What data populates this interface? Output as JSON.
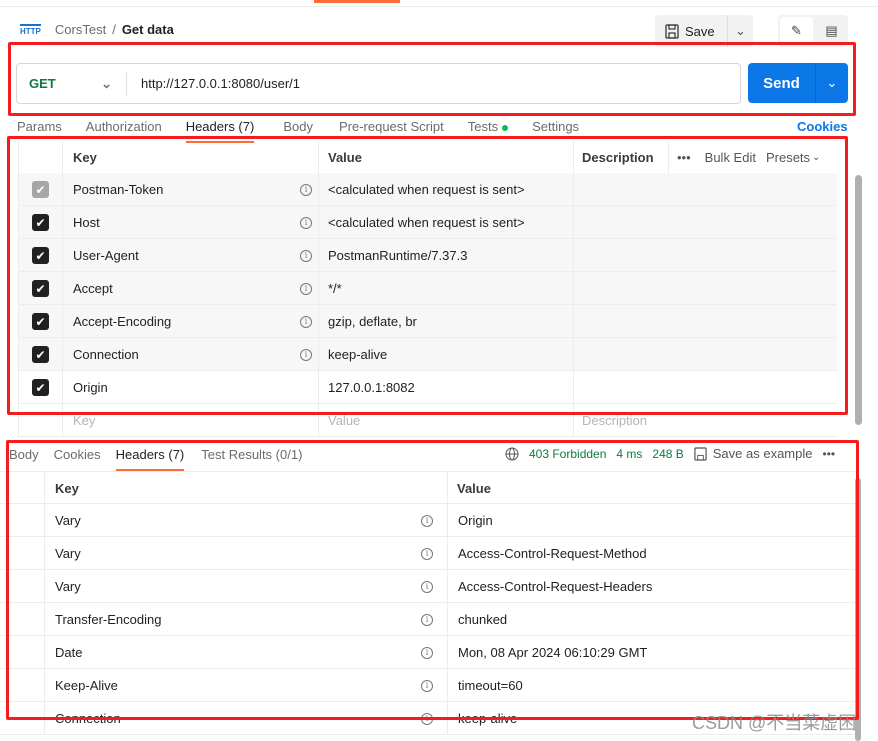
{
  "breadcrumb": {
    "icon": "http-icon",
    "icon_text": "HTTP",
    "collection": "CorsTest",
    "separator": "/",
    "request": "Get data"
  },
  "toolbar": {
    "save_label": "Save"
  },
  "request": {
    "method": "GET",
    "url": "http://127.0.0.1:8080/user/1",
    "send_label": "Send"
  },
  "request_tabs": [
    {
      "label": "Params"
    },
    {
      "label": "Authorization"
    },
    {
      "label": "Headers (7)",
      "active": true
    },
    {
      "label": "Body"
    },
    {
      "label": "Pre-request Script"
    },
    {
      "label": "Tests",
      "dot_color": "#0cbb52"
    },
    {
      "label": "Settings"
    }
  ],
  "cookies_label": "Cookies",
  "request_headers": {
    "columns": {
      "key": "Key",
      "value": "Value",
      "description": "Description",
      "bulk_edit": "Bulk Edit",
      "presets": "Presets"
    },
    "rows": [
      {
        "checked": true,
        "disabled": true,
        "key": "Postman-Token",
        "value": "<calculated when request is sent>",
        "auto": true
      },
      {
        "checked": true,
        "key": "Host",
        "value": "<calculated when request is sent>",
        "auto": true
      },
      {
        "checked": true,
        "key": "User-Agent",
        "value": "PostmanRuntime/7.37.3",
        "auto": true
      },
      {
        "checked": true,
        "key": "Accept",
        "value": "*/*",
        "auto": true
      },
      {
        "checked": true,
        "key": "Accept-Encoding",
        "value": "gzip, deflate, br",
        "auto": true
      },
      {
        "checked": true,
        "key": "Connection",
        "value": "keep-alive",
        "auto": true
      },
      {
        "checked": true,
        "key": "Origin",
        "value": "127.0.0.1:8082",
        "auto": false
      }
    ],
    "placeholder": {
      "key": "Key",
      "value": "Value",
      "description": "Description"
    }
  },
  "response_tabs": [
    {
      "label": "Body"
    },
    {
      "label": "Cookies"
    },
    {
      "label": "Headers (7)",
      "active": true
    },
    {
      "label": "Test Results (0/1)"
    }
  ],
  "response_status": {
    "code": "403 Forbidden",
    "time": "4 ms",
    "size": "248 B",
    "save_example": "Save as example",
    "status_color": "#0a7d3e"
  },
  "response_headers": {
    "columns": {
      "key": "Key",
      "value": "Value"
    },
    "rows": [
      {
        "key": "Vary",
        "value": "Origin"
      },
      {
        "key": "Vary",
        "value": "Access-Control-Request-Method"
      },
      {
        "key": "Vary",
        "value": "Access-Control-Request-Headers"
      },
      {
        "key": "Transfer-Encoding",
        "value": "chunked"
      },
      {
        "key": "Date",
        "value": "Mon, 08 Apr 2024 06:10:29 GMT"
      },
      {
        "key": "Keep-Alive",
        "value": "timeout=60"
      },
      {
        "key": "Connection",
        "value": "keep-alive"
      }
    ]
  },
  "annotation_color": "#f41c1c",
  "watermark": "CSDN @不当菜虚困"
}
